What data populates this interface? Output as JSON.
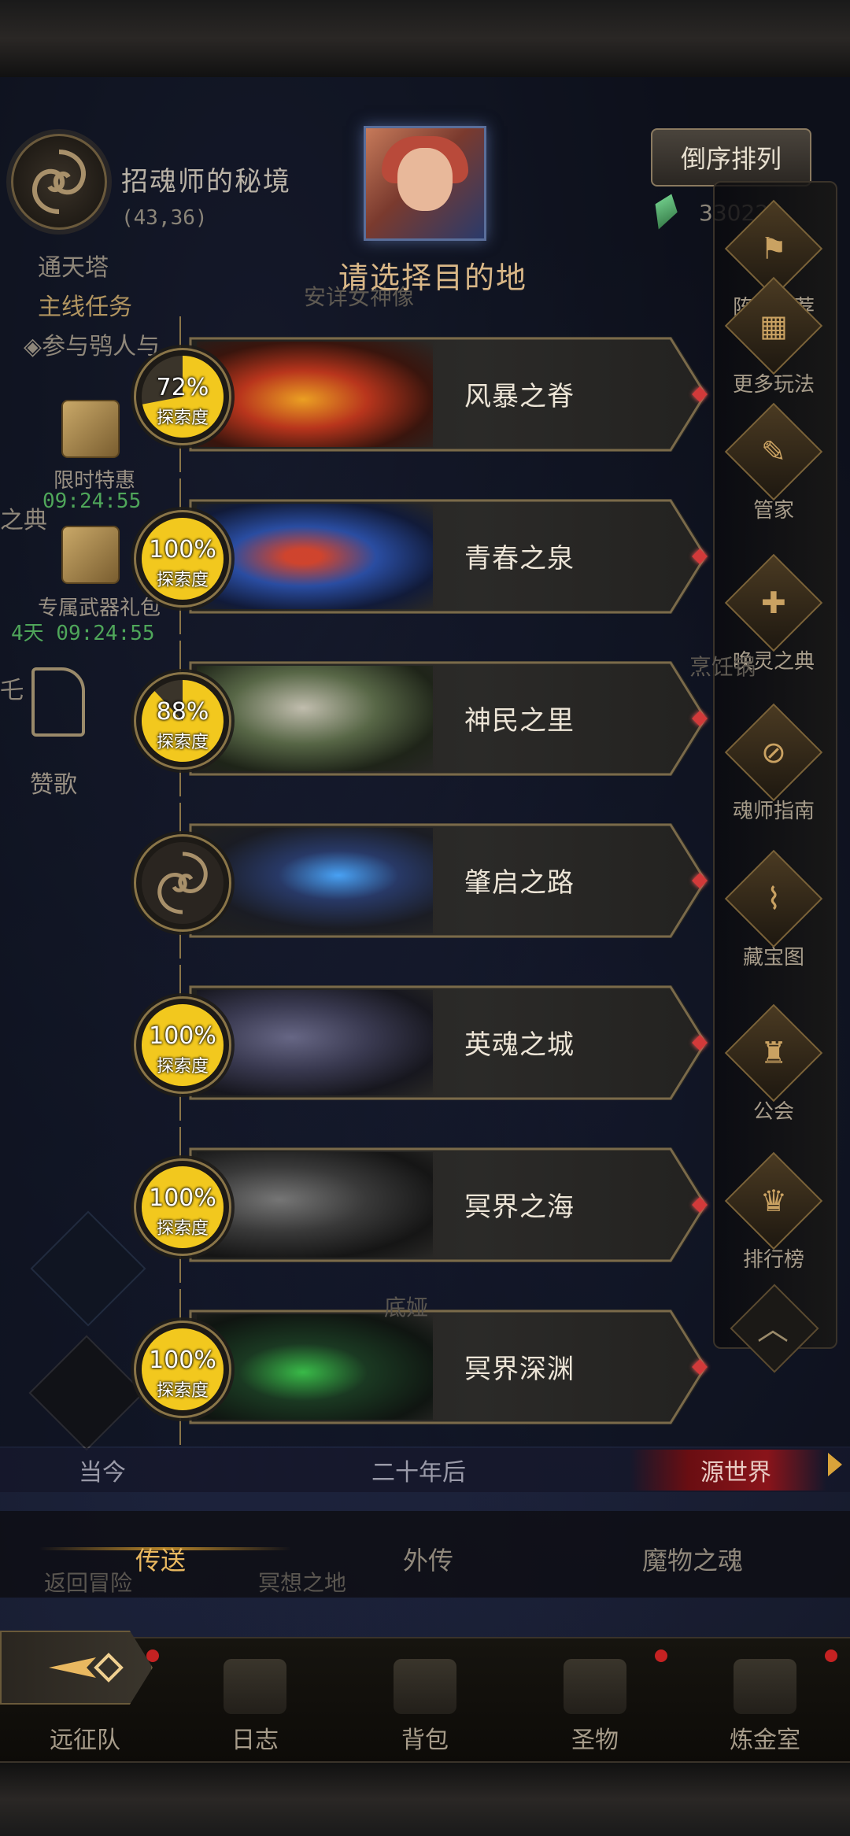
{
  "header": {
    "map_name": "招魂师的秘境",
    "coords": "(43,36)",
    "sort_button": "倒序排列",
    "currency": "33022"
  },
  "quests": {
    "tower": "通天塔",
    "main": "主线任务",
    "join": "◈参与鸮人与",
    "under_label": "安详女神像"
  },
  "left_sidebar": {
    "gift1_label": "限时特惠",
    "gift1_timer": "09:24:55",
    "gift2_label": "专属武器礼包",
    "gift2_timer": "4天 09:24:55",
    "cut1": "之典",
    "cut2": "乇",
    "hymn": "赞歌"
  },
  "right_sidebar": [
    {
      "label": "阵容推荐",
      "icon": "banner-icon"
    },
    {
      "label": "更多玩法",
      "icon": "chest-icon"
    },
    {
      "label": "管家",
      "icon": "quill-icon"
    },
    {
      "label": "唤灵之典",
      "icon": "book-icon"
    },
    {
      "label": "魂师指南",
      "icon": "compass-icon"
    },
    {
      "label": "藏宝图",
      "icon": "map-icon"
    },
    {
      "label": "公会",
      "icon": "guild-icon"
    },
    {
      "label": "排行榜",
      "icon": "trophy-icon"
    }
  ],
  "right_sidebar_under": "烹饪锅",
  "modal": {
    "title": "请选择目的地",
    "explore_label": "探索度",
    "destinations": [
      {
        "name": "风暴之脊",
        "progress": "72%",
        "fraction": 0.72,
        "theme": "lava"
      },
      {
        "name": "青春之泉",
        "progress": "100%",
        "fraction": 1.0,
        "theme": "ice"
      },
      {
        "name": "神民之里",
        "progress": "88%",
        "fraction": 0.88,
        "theme": "ruins"
      },
      {
        "name": "肇启之路",
        "progress": "",
        "fraction": 0,
        "theme": "portal"
      },
      {
        "name": "英魂之城",
        "progress": "100%",
        "fraction": 1.0,
        "theme": "city"
      },
      {
        "name": "冥界之海",
        "progress": "100%",
        "fraction": 1.0,
        "theme": "statue"
      },
      {
        "name": "冥界深渊",
        "progress": "100%",
        "fraction": 1.0,
        "theme": "abyss"
      }
    ]
  },
  "eras": {
    "now": "当今",
    "later": "二十年后",
    "origin": "源世界"
  },
  "sub_tabs": {
    "teleport": "传送",
    "side_story": "外传",
    "monster_soul": "魔物之魂"
  },
  "faded": {
    "return": "返回冒险",
    "dream": "冥想之地",
    "scene_label": "底娅"
  },
  "nav": {
    "expedition": "远征队",
    "log": "日志",
    "bag": "背包",
    "relic": "圣物",
    "alchemy": "炼金室"
  },
  "colors": {
    "accent_gold": "#d9b787",
    "progress_yellow": "#f2c81e",
    "origin_red": "#d23a3a",
    "timer_green": "#4fa65a"
  }
}
